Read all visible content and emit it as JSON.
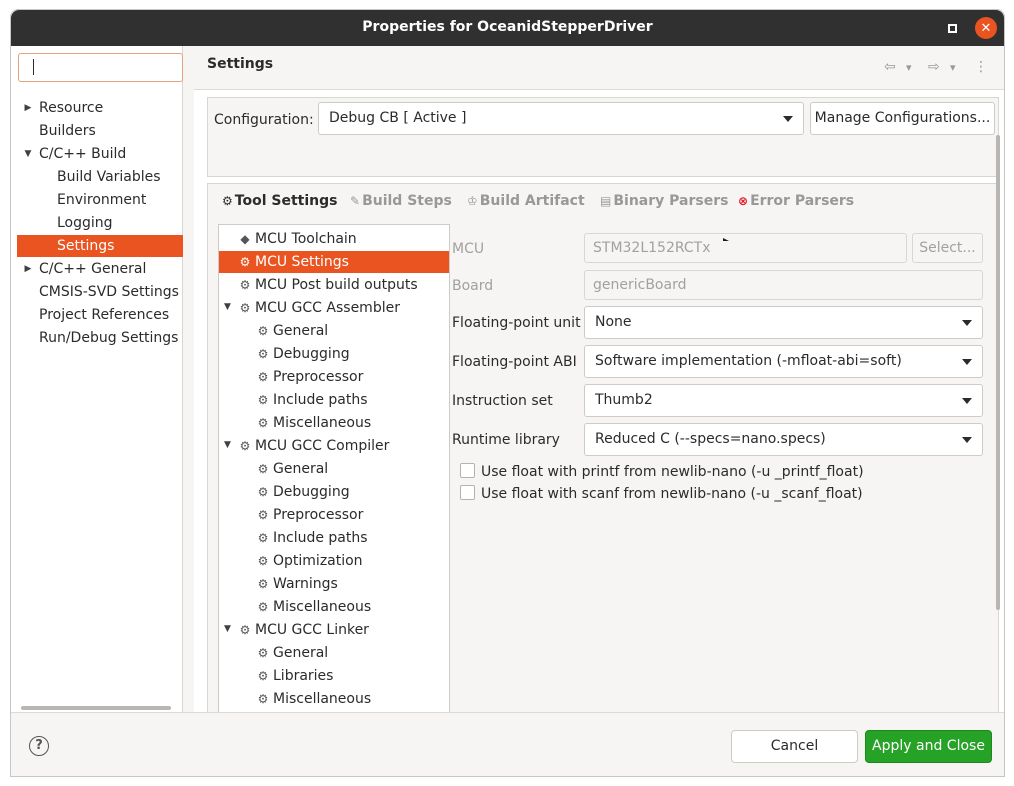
{
  "window": {
    "title": "Properties for OceanidStepperDriver"
  },
  "left_nav": {
    "filter_value": "",
    "items": [
      {
        "label": "Resource",
        "expand": "▶"
      },
      {
        "label": "Builders"
      },
      {
        "label": "C/C++ Build",
        "expand": "▼"
      },
      {
        "label": "Build Variables"
      },
      {
        "label": "Environment"
      },
      {
        "label": "Logging"
      },
      {
        "label": "Settings"
      },
      {
        "label": "C/C++ General",
        "expand": "▶"
      },
      {
        "label": "CMSIS-SVD Settings"
      },
      {
        "label": "Project References"
      },
      {
        "label": "Run/Debug Settings"
      }
    ]
  },
  "header": {
    "title": "Settings",
    "back_icon": "⇦",
    "fwd_icon": "⇨",
    "menu_icon": "⋮",
    "drop_icon": "▾"
  },
  "config": {
    "label": "Configuration:",
    "value": "Debug CB  [ Active ]",
    "manage_label": "Manage Configurations..."
  },
  "tabs": [
    {
      "label": "Tool Settings",
      "icon": "⚙"
    },
    {
      "label": "Build Steps",
      "icon": "✎"
    },
    {
      "label": "Build Artifact",
      "icon": "♔"
    },
    {
      "label": "Binary Parsers",
      "icon": "▤"
    },
    {
      "label": "Error Parsers",
      "icon": "⊗"
    }
  ],
  "tool_tree": [
    {
      "label": "MCU Toolchain",
      "icon": "◆"
    },
    {
      "label": "MCU Settings",
      "icon": "⚙"
    },
    {
      "label": "MCU Post build outputs",
      "icon": "⚙"
    },
    {
      "label": "MCU GCC Assembler",
      "icon": "⚙",
      "expand": "▼"
    },
    {
      "label": "General",
      "icon": "⚙"
    },
    {
      "label": "Debugging",
      "icon": "⚙"
    },
    {
      "label": "Preprocessor",
      "icon": "⚙"
    },
    {
      "label": "Include paths",
      "icon": "⚙"
    },
    {
      "label": "Miscellaneous",
      "icon": "⚙"
    },
    {
      "label": "MCU GCC Compiler",
      "icon": "⚙",
      "expand": "▼"
    },
    {
      "label": "General",
      "icon": "⚙"
    },
    {
      "label": "Debugging",
      "icon": "⚙"
    },
    {
      "label": "Preprocessor",
      "icon": "⚙"
    },
    {
      "label": "Include paths",
      "icon": "⚙"
    },
    {
      "label": "Optimization",
      "icon": "⚙"
    },
    {
      "label": "Warnings",
      "icon": "⚙"
    },
    {
      "label": "Miscellaneous",
      "icon": "⚙"
    },
    {
      "label": "MCU GCC Linker",
      "icon": "⚙",
      "expand": "▼"
    },
    {
      "label": "General",
      "icon": "⚙"
    },
    {
      "label": "Libraries",
      "icon": "⚙"
    },
    {
      "label": "Miscellaneous",
      "icon": "⚙"
    }
  ],
  "form": {
    "mcu_label": "MCU",
    "mcu_value": "STM32L152RCTx",
    "select_label": "Select...",
    "board_label": "Board",
    "board_value": "genericBoard",
    "fpu_label": "Floating-point unit",
    "fpu_value": "None",
    "fpabi_label": "Floating-point ABI",
    "fpabi_value": "Software implementation (-mfloat-abi=soft)",
    "iset_label": "Instruction set",
    "iset_value": "Thumb2",
    "rtlib_label": "Runtime library",
    "rtlib_value": "Reduced C (--specs=nano.specs)",
    "printf_label": "Use float with printf from newlib-nano (-u _printf_float)",
    "scanf_label": "Use float with scanf from newlib-nano (-u _scanf_float)"
  },
  "footer": {
    "help_icon": "?",
    "cancel_label": "Cancel",
    "apply_label": "Apply and Close"
  },
  "colors": {
    "accent": "#e95420",
    "apply": "#26a226",
    "titlebar": "#303030"
  }
}
